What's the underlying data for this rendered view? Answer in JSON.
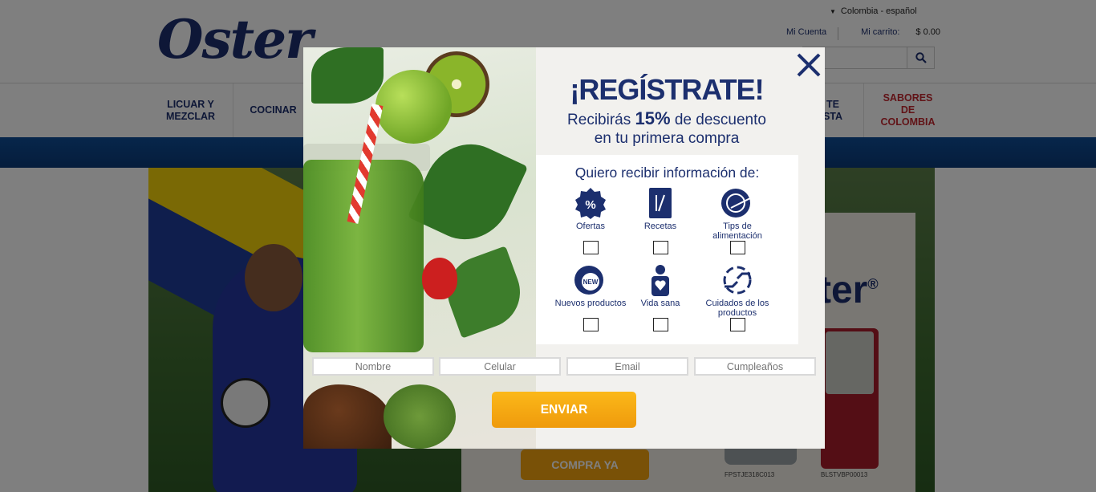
{
  "header": {
    "brand": "Oster",
    "brand_mark": "®",
    "region": "Colombia - español",
    "account": "Mi Cuenta",
    "cart_label": "Mi carrito:",
    "cart_value": "$ 0.00"
  },
  "nav": {
    "items": [
      {
        "label": "LICUAR Y\nMEZCLAR"
      },
      {
        "label": "COCINAR"
      },
      {
        "label": "TE\nSTA"
      },
      {
        "label": "SABORES\nDE\nCOLOMBIA"
      }
    ]
  },
  "hero": {
    "brand": "ter",
    "cta": "COMPRA YA",
    "models": [
      "FPSTJE318C013",
      "BLSTVBP00013"
    ]
  },
  "modal": {
    "title": "¡REGÍSTRATE!",
    "subtitle_pre": "Recibirás",
    "subtitle_percent": "15%",
    "subtitle_post": "de descuento",
    "subtitle_line2": "en tu primera compra",
    "pref_title": "Quiero recibir información de:",
    "preferences": [
      {
        "label": "Ofertas",
        "icon": "percent-badge-icon"
      },
      {
        "label": "Recetas",
        "icon": "recipe-book-icon"
      },
      {
        "label": "Tips de alimentación",
        "icon": "plate-icon"
      },
      {
        "label": "Nuevos productos",
        "icon": "new-badge-icon"
      },
      {
        "label": "Vida sana",
        "icon": "healthy-person-icon"
      },
      {
        "label": "Cuidados de los productos",
        "icon": "hands-care-icon"
      }
    ],
    "fields": {
      "name_placeholder": "Nombre",
      "phone_placeholder": "Celular",
      "email_placeholder": "Email",
      "birthday_placeholder": "Cumpleaños"
    },
    "submit": "ENVIAR",
    "close_symbol": "✕"
  },
  "colors": {
    "brand_navy": "#1c2f6e",
    "accent_orange": "#f2a20f",
    "accent_red": "#c3262e"
  }
}
